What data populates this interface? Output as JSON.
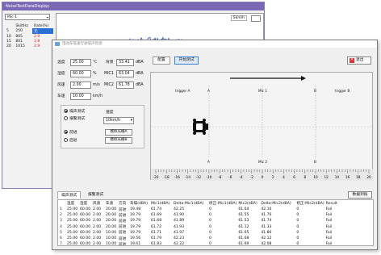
{
  "back_window": {
    "title": "NoiseTestDataDisplay",
    "combo_value": "Mic-1",
    "table_headers": [
      "",
      "SkiltHz",
      "Rate(%)"
    ],
    "table_rows": [
      [
        "5",
        "250",
        "元"
      ],
      [
        "10",
        "805",
        "2.9"
      ],
      [
        "15",
        "801",
        "2.8"
      ],
      [
        "20",
        "1015",
        "2.9"
      ]
    ],
    "chart_label": "Skm/h"
  },
  "dialog": {
    "title": "电动车低速行驶噪声检测",
    "params": {
      "temp_label": "温度",
      "temp_value": "25.00",
      "temp_unit": "℃",
      "humidity_label": "湿度",
      "humidity_value": "60.00",
      "humidity_unit": "%",
      "wind_label": "风速",
      "wind_value": "2.00",
      "wind_unit": "m/s",
      "speed_label": "车速",
      "speed_value": "10.00",
      "speed_unit": "km/h",
      "bg_label": "背景",
      "bg_value": "33.41",
      "bg_unit": "dBA",
      "mic1_label": "MIC1",
      "mic1_value": "63.04",
      "mic1_unit": "dBA",
      "mic2_label": "MIC2",
      "mic2_value": "61.78",
      "mic2_unit": "dBA"
    },
    "buttons": {
      "config": "配置",
      "start": "开始测试",
      "exit": "退出",
      "sim_a": "模拟光栅A",
      "sim_b": "模拟光栅B",
      "export": "数据到账"
    },
    "mode": {
      "option1": "噪声测试",
      "option2": "报警测试",
      "option3": "前进",
      "option4": "后退",
      "speed_label": "速度",
      "speed_select": "10km/h"
    },
    "scene": {
      "trigger_a": "trigger A",
      "trigger_b": "trigger B",
      "a_top": "A",
      "a_bottom": "A",
      "b_top": "B",
      "b_bottom": "B",
      "mic1": "Mic 1",
      "mic2": "Mic 2",
      "ruler_ticks": [
        "-20",
        "-18",
        "-16",
        "-14",
        "-12",
        "-10",
        "-8",
        "-6",
        "-4",
        "-2",
        "0",
        "2",
        "4",
        "6",
        "8",
        "10",
        "12",
        "14",
        "16",
        "18",
        "20"
      ]
    },
    "tabs": [
      "噪声测试",
      "报警测试"
    ],
    "grid": {
      "headers": [
        "",
        "温度",
        "湿度",
        "风速",
        "车速",
        "方向",
        "背噪(dBA)",
        "Mic1(dBA)",
        "Delta-Mic1(dBA)",
        "修正-Mic1(dBA)",
        "Mic2(dBA)",
        "Delta-Mic2(dBA)",
        "修正-Mic2(dBA)",
        "Result"
      ],
      "rows": [
        [
          "1",
          "25.00",
          "60.00",
          "2.00",
          "20.00",
          "前进",
          "19.48",
          "61.74",
          "42.25",
          "0",
          "61.64",
          "42.16",
          "0",
          "Fail"
        ],
        [
          "2",
          "25.00",
          "60.00",
          "2.00",
          "20.00",
          "前进",
          "19.79",
          "61.69",
          "41.90",
          "0",
          "61.55",
          "41.76",
          "0",
          "Fail"
        ],
        [
          "3",
          "25.00",
          "60.00",
          "2.00",
          "20.00",
          "前进",
          "19.79",
          "61.68",
          "41.89",
          "0",
          "61.53",
          "41.74",
          "0",
          "Fail"
        ],
        [
          "4",
          "25.00",
          "60.00",
          "2.00",
          "20.00",
          "前进",
          "19.79",
          "61.72",
          "41.93",
          "0",
          "61.12",
          "41.33",
          "0",
          "Fail"
        ],
        [
          "5",
          "25.00",
          "60.00",
          "2.00",
          "10.00",
          "前进",
          "19.79",
          "61.71",
          "41.97",
          "0",
          "61.65",
          "41.86",
          "0",
          "Fail"
        ],
        [
          "6",
          "25.00",
          "60.00",
          "2.00",
          "10.00",
          "前进",
          "19.56",
          "61.79",
          "42.23",
          "0",
          "61.68",
          "42.12",
          "0",
          "Fail"
        ],
        [
          "7",
          "25.00",
          "60.00",
          "2.00",
          "10.00",
          "前进",
          "19.61",
          "61.83",
          "42.22",
          "0",
          "61.69",
          "42.08",
          "0",
          "Fail"
        ],
        [
          "8",
          "25.00",
          "60.00",
          "2.00",
          "10.00",
          "前进",
          "19.61",
          "61.83",
          "42.22",
          "0",
          "61.70",
          "42.09",
          "0",
          "Fail"
        ]
      ]
    }
  },
  "colors": {
    "back_title_bg": "#7b68b5",
    "chart_line": "#1f4fb0",
    "exit_icon": "#d33333",
    "active_btn": "#3b7fd6"
  }
}
